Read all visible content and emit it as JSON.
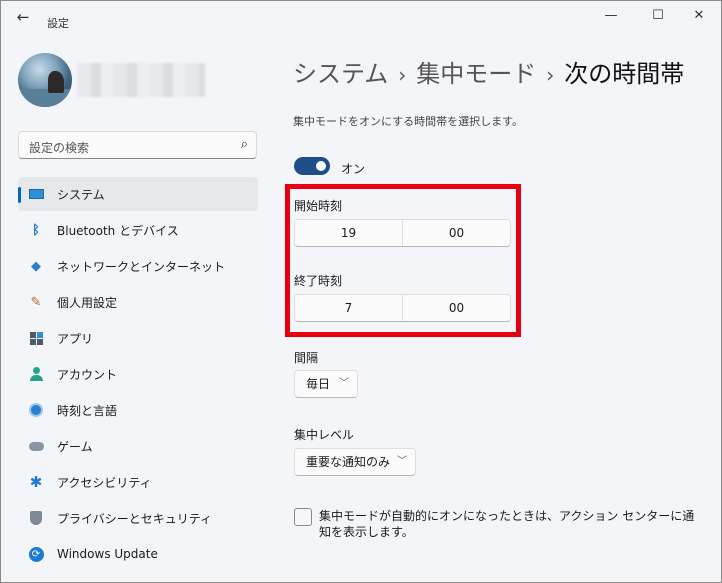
{
  "window": {
    "title": "設定",
    "back_icon": "back-arrow-icon",
    "controls": {
      "minimize": "—",
      "maximize": "☐",
      "close": "✕"
    }
  },
  "search": {
    "placeholder": "設定の検索"
  },
  "sidebar": {
    "items": [
      {
        "label": "システム",
        "icon": "system-icon",
        "active": true
      },
      {
        "label": "Bluetooth とデバイス",
        "icon": "bluetooth-icon"
      },
      {
        "label": "ネットワークとインターネット",
        "icon": "wifi-icon"
      },
      {
        "label": "個人用設定",
        "icon": "brush-icon"
      },
      {
        "label": "アプリ",
        "icon": "apps-icon"
      },
      {
        "label": "アカウント",
        "icon": "account-icon"
      },
      {
        "label": "時刻と言語",
        "icon": "time-language-icon"
      },
      {
        "label": "ゲーム",
        "icon": "gamepad-icon"
      },
      {
        "label": "アクセシビリティ",
        "icon": "accessibility-icon"
      },
      {
        "label": "プライバシーとセキュリティ",
        "icon": "shield-icon"
      },
      {
        "label": "Windows Update",
        "icon": "update-icon"
      }
    ]
  },
  "breadcrumb": [
    "システム",
    "集中モード",
    "次の時間帯"
  ],
  "description": "集中モードをオンにする時間帯を選択します。",
  "toggle": {
    "label": "オン",
    "state": "on"
  },
  "start_time": {
    "label": "開始時刻",
    "hour": "19",
    "minute": "00"
  },
  "end_time": {
    "label": "終了時刻",
    "hour": "7",
    "minute": "00"
  },
  "interval": {
    "label": "間隔",
    "value": "毎日"
  },
  "focus_level": {
    "label": "集中レベル",
    "value": "重要な通知のみ"
  },
  "notify_checkbox": {
    "checked": false,
    "label": "集中モードが自動的にオンになったときは、アクション センターに通知を表示します。"
  },
  "colors": {
    "accent": "#0067c0",
    "toggle": "#1d4e89",
    "highlight": "#e60012"
  }
}
